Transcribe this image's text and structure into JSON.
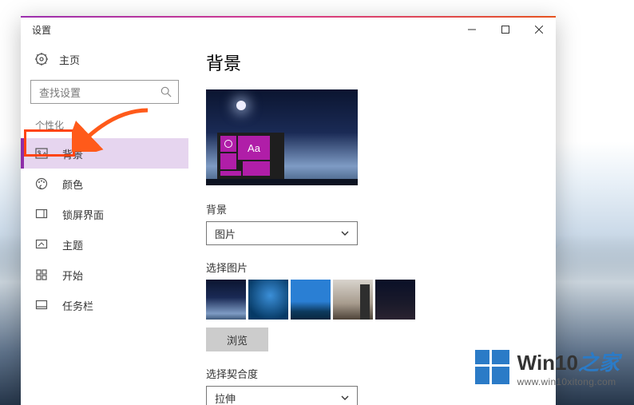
{
  "window": {
    "title": "设置"
  },
  "home_label": "主页",
  "search": {
    "placeholder": "查找设置"
  },
  "section_label": "个性化",
  "nav": {
    "background": "背景",
    "colors": "颜色",
    "lockscreen": "锁屏界面",
    "themes": "主题",
    "start": "开始",
    "taskbar": "任务栏"
  },
  "main": {
    "title": "背景",
    "preview_tile_label": "Aa",
    "bg_label": "背景",
    "bg_value": "图片",
    "choose_label": "选择图片",
    "browse_label": "浏览",
    "fit_label": "选择契合度",
    "fit_value": "拉伸"
  },
  "watermark": {
    "brand_main": "Win10",
    "brand_suffix": "之家",
    "url": "www.win10xitong.com"
  }
}
